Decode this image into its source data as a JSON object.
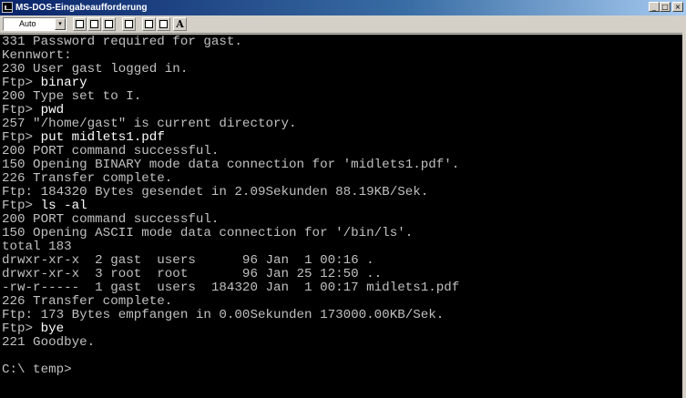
{
  "window": {
    "title": "MS-DOS-Eingabeaufforderung",
    "controls": {
      "minimize": "_",
      "restore": "□",
      "close": "×"
    }
  },
  "toolbar": {
    "font_size": "Auto",
    "dropdown_glyph": "▾",
    "font_button": "A",
    "icons": [
      "mark-icon",
      "copy-icon",
      "paste-icon",
      "fullscreen-icon",
      "properties-icon",
      "background-icon",
      "font-icon"
    ]
  },
  "terminal": {
    "lines": [
      {
        "text": "331 Password required for gast."
      },
      {
        "text": "Kennwort:"
      },
      {
        "text": "230 User gast logged in."
      },
      {
        "prompt": "Ftp> ",
        "cmd": "binary"
      },
      {
        "text": "200 Type set to I."
      },
      {
        "prompt": "Ftp> ",
        "cmd": "pwd"
      },
      {
        "text": "257 \"/home/gast\" is current directory."
      },
      {
        "prompt": "Ftp> ",
        "cmd": "put midlets1.pdf"
      },
      {
        "text": "200 PORT command successful."
      },
      {
        "text": "150 Opening BINARY mode data connection for 'midlets1.pdf'."
      },
      {
        "text": "226 Transfer complete."
      },
      {
        "text": "Ftp: 184320 Bytes gesendet in 2.09Sekunden 88.19KB/Sek."
      },
      {
        "prompt": "Ftp> ",
        "cmd": "ls -al"
      },
      {
        "text": "200 PORT command successful."
      },
      {
        "text": "150 Opening ASCII mode data connection for '/bin/ls'."
      },
      {
        "text": "total 183"
      },
      {
        "text": "drwxr-xr-x  2 gast  users      96 Jan  1 00:16 ."
      },
      {
        "text": "drwxr-xr-x  3 root  root       96 Jan 25 12:50 .."
      },
      {
        "text": "-rw-r-----  1 gast  users  184320 Jan  1 00:17 midlets1.pdf"
      },
      {
        "text": "226 Transfer complete."
      },
      {
        "text": "Ftp: 173 Bytes empfangen in 0.00Sekunden 173000.00KB/Sek."
      },
      {
        "prompt": "Ftp> ",
        "cmd": "bye"
      },
      {
        "text": "221 Goodbye."
      },
      {
        "text": ""
      },
      {
        "text": "C:\\ temp>"
      }
    ]
  },
  "colors": {
    "terminal_bg": "#000000",
    "terminal_fg": "#c0c0c0",
    "command_fg": "#ffffff"
  }
}
